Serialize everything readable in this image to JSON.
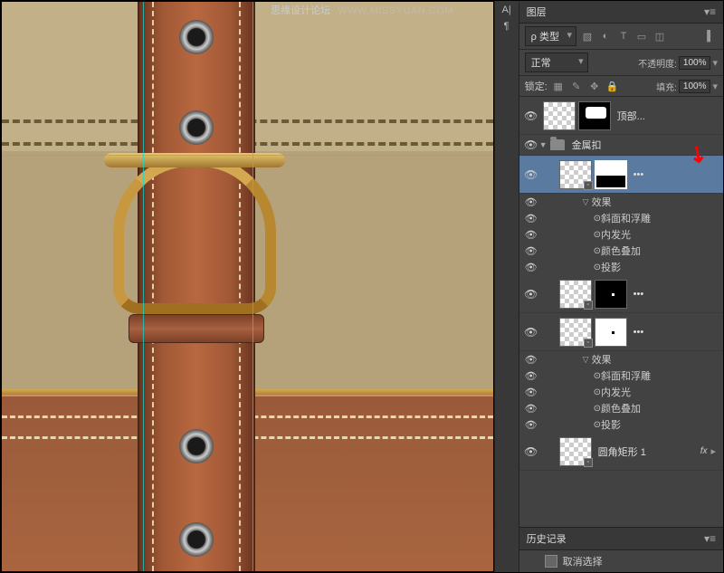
{
  "watermark": {
    "text": "思缘设计论坛",
    "url": "WWW.MISSYUAN.COM"
  },
  "panel": {
    "layers_title": "图层",
    "history_title": "历史记录",
    "filter_label": "ρ 类型",
    "blend_mode": "正常",
    "opacity_label": "不透明度:",
    "opacity_value": "100%",
    "lock_label": "锁定:",
    "fill_label": "填充:",
    "fill_value": "100%"
  },
  "side_tabs": [
    "A|",
    "¶"
  ],
  "layers": {
    "top_layer": "顶部...",
    "group_name": "金属扣",
    "effects_label": "效果",
    "fx_bevel": "斜面和浮雕",
    "fx_inner_glow": "内发光",
    "fx_color_overlay": "颜色叠加",
    "fx_drop_shadow": "投影",
    "rounded_rect": "圆角矩形 1",
    "fx_badge": "fx",
    "more": "•••"
  },
  "history": {
    "item1": "取消选择"
  }
}
